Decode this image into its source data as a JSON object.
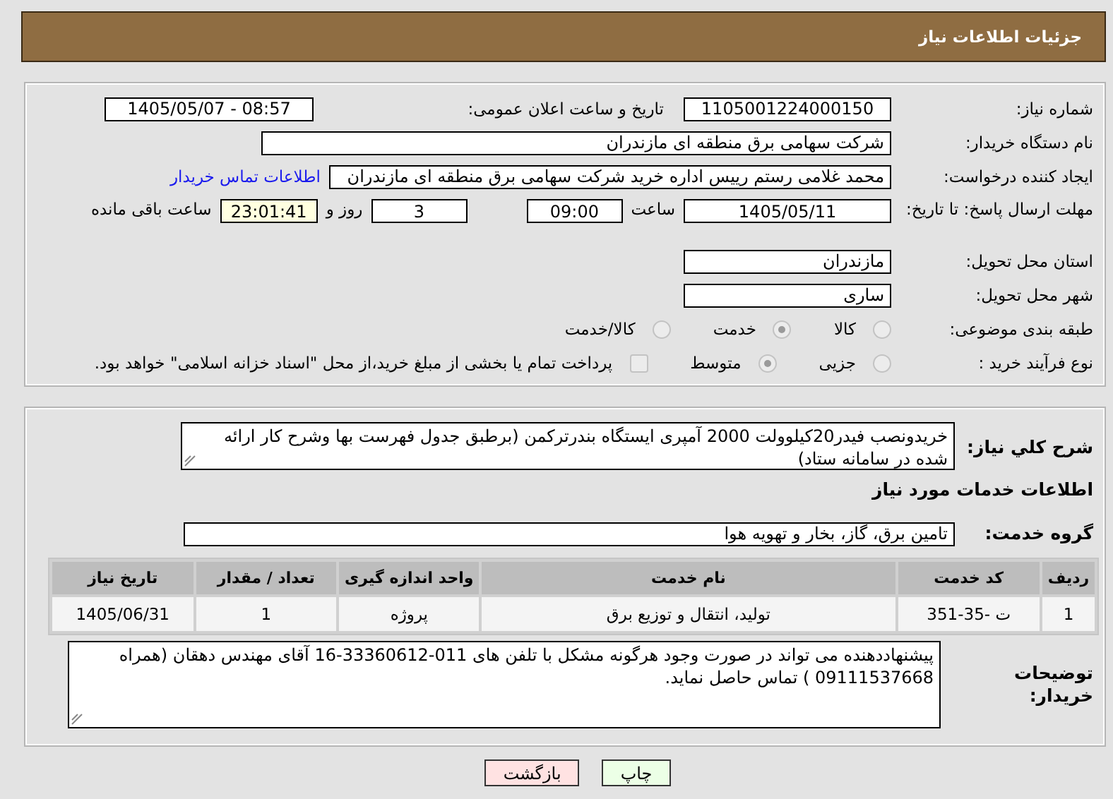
{
  "header": {
    "title": "جزئیات اطلاعات نیاز"
  },
  "need_number": {
    "label": "شماره نیاز:",
    "value": "1105001224000150"
  },
  "announce": {
    "label": "تاریخ و ساعت اعلان عمومی:",
    "value": "1405/05/07 - 08:57"
  },
  "buyer_org": {
    "label": "نام دستگاه خریدار:",
    "value": "شرکت سهامی برق منطقه ای مازندران"
  },
  "requester": {
    "label": "ایجاد کننده درخواست:",
    "value": "محمد غلامی رستم رییس اداره خرید شرکت سهامی برق منطقه ای مازندران",
    "link": "اطلاعات تماس خریدار"
  },
  "deadline": {
    "label": "مهلت ارسال پاسخ: تا تاریخ:",
    "date": "1405/05/11",
    "time_label": "ساعت",
    "time": "09:00",
    "days": "3",
    "days_label": "روز و",
    "remaining": "23:01:41",
    "remaining_label": "ساعت باقی مانده"
  },
  "province": {
    "label": "استان محل تحویل:",
    "value": "مازندران"
  },
  "city": {
    "label": "شهر محل تحویل:",
    "value": "ساری"
  },
  "category": {
    "label": "طبقه بندی موضوعی:",
    "options": [
      {
        "label": "کالا",
        "selected": false
      },
      {
        "label": "خدمت",
        "selected": true
      },
      {
        "label": "کالا/خدمت",
        "selected": false
      }
    ]
  },
  "process": {
    "label": "نوع فرآیند خرید :",
    "options": [
      {
        "label": "جزیی",
        "selected": false
      },
      {
        "label": "متوسط",
        "selected": true
      }
    ],
    "payment": {
      "label": "پرداخت تمام یا بخشی از مبلغ خرید،از محل \"اسناد خزانه اسلامی\" خواهد بود.",
      "checked": false
    }
  },
  "description": {
    "label": "شرح کلي نیاز:",
    "value": "خریدونصب فیدر20کیلوولت 2000 آمپری ایستگاه بندرترکمن (برطبق جدول فهرست بها وشرح کار ارائه شده در سامانه ستاد)"
  },
  "services_title": "اطلاعات خدمات مورد نیاز",
  "service_group": {
    "label": "گروه خدمت:",
    "value": "تامین برق، گاز، بخار و تهویه هوا"
  },
  "table": {
    "columns": [
      "ردیف",
      "کد خدمت",
      "نام خدمت",
      "واحد اندازه گیری",
      "تعداد / مقدار",
      "تاریخ نیاز"
    ],
    "rows": [
      [
        "1",
        "ت -35-351",
        "تولید، انتقال و توزیع برق",
        "پروژه",
        "1",
        "1405/06/31"
      ]
    ]
  },
  "notes": {
    "label": "توضیحات خریدار:",
    "value": "پیشنهاددهنده می تواند در صورت وجود هرگونه مشکل با تلفن های 011-33360612-16 آقای مهندس دهقان (همراه  09111537668 ) تماس حاصل نماید."
  },
  "buttons": [
    {
      "label": "چاپ",
      "kind": "print"
    },
    {
      "label": "بازگشت",
      "kind": "back"
    }
  ]
}
